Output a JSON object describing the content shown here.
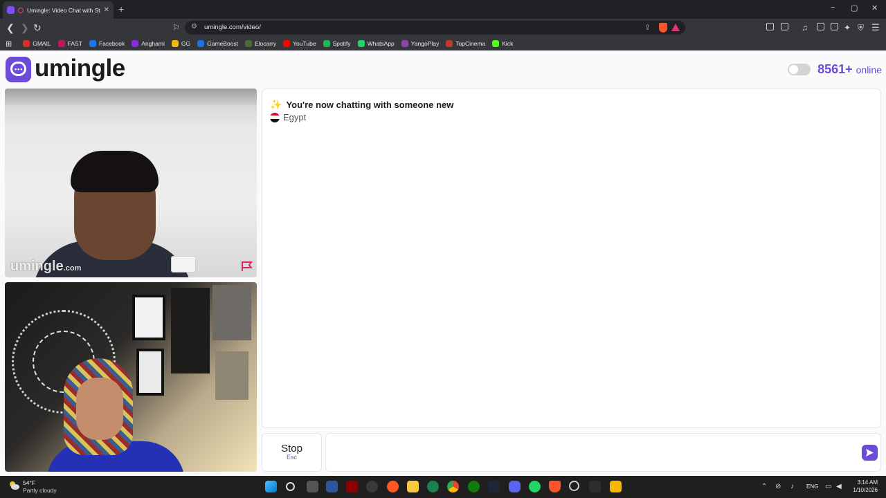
{
  "browser": {
    "tab_title": "Umingle: Video Chat with Strangers",
    "new_tab": "+",
    "url": "umingle.com/video/",
    "minimize": "−",
    "maximize": "▢",
    "close": "✕"
  },
  "bookmarks": [
    {
      "label": "GMAIL",
      "color": "#d93025"
    },
    {
      "label": "FAST",
      "color": "#c2185b"
    },
    {
      "label": "Facebook",
      "color": "#1877f2"
    },
    {
      "label": "Anghami",
      "color": "#8a2be2"
    },
    {
      "label": "GG",
      "color": "#f2b90c"
    },
    {
      "label": "GameBoost",
      "color": "#1a73e8"
    },
    {
      "label": "Elocarry",
      "color": "#4a6b3a"
    },
    {
      "label": "YouTube",
      "color": "#ff0000"
    },
    {
      "label": "Spotify",
      "color": "#1db954"
    },
    {
      "label": "WhatsApp",
      "color": "#25d366"
    },
    {
      "label": "YangoPlay",
      "color": "#8e44ad"
    },
    {
      "label": "TopCinema",
      "color": "#c0392b"
    },
    {
      "label": "Kick",
      "color": "#53fc18"
    }
  ],
  "header": {
    "logo": "umingle",
    "online_count": "8561+",
    "online_label": "online"
  },
  "video": {
    "watermark": "umingle",
    "watermark_suffix": ".com"
  },
  "chat": {
    "message": "You're now chatting with someone new",
    "country": "Egypt",
    "input_value": ""
  },
  "controls": {
    "stop_label": "Stop",
    "stop_hint": "Esc"
  },
  "taskbar": {
    "temperature": "54°F",
    "weather": "Partly cloudy",
    "language": "ENG",
    "time": "3:14 AM",
    "date": "1/10/2026"
  },
  "colors": {
    "accent": "#6c4bd8"
  }
}
